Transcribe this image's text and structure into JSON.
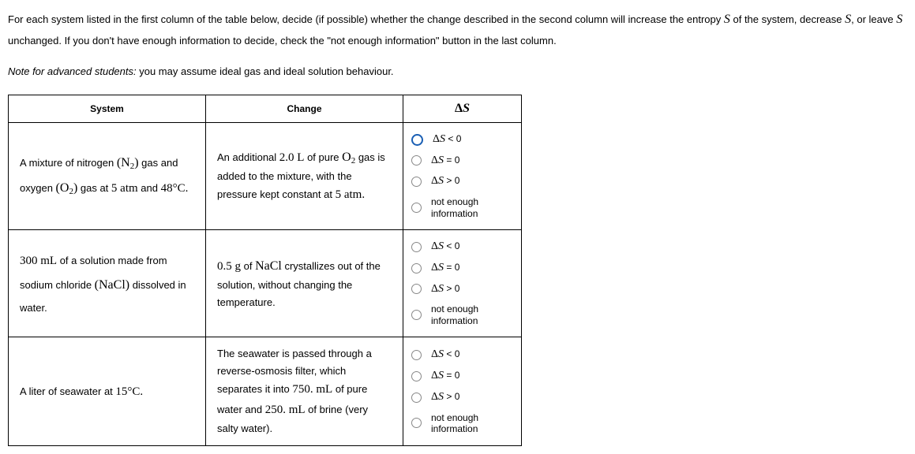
{
  "instructions_p1": "For each system listed in the first column of the table below, decide (if possible) whether the change described in the second column will increase the entropy ",
  "instructions_s1": "S",
  "instructions_p2": " of the system, decrease ",
  "instructions_s2": "S",
  "instructions_p3": ", or leave ",
  "instructions_s3": "S",
  "instructions_p4": " unchanged. If you don't have enough information to decide, check the \"not enough information\" button in the last column.",
  "note_label": "Note for advanced students:",
  "note_text": " you may assume ideal gas and ideal solution behaviour.",
  "headers": {
    "system": "System",
    "change": "Change",
    "delta_sym": "Δ",
    "delta_s": "S"
  },
  "options": {
    "lt": {
      "sym": "Δ",
      "s": "S",
      "op": " < 0"
    },
    "eq": {
      "sym": "Δ",
      "s": "S",
      "op": " = 0"
    },
    "gt": {
      "sym": "Δ",
      "s": "S",
      "op": " > 0"
    },
    "nei": "not enough information"
  },
  "rows": [
    {
      "system": {
        "t1": "A mixture of nitrogen ",
        "f1": "(N",
        "f1sub": "2",
        "f1end": ")",
        "t2": " gas and oxygen ",
        "f2": "(O",
        "f2sub": "2",
        "f2end": ")",
        "t3": " gas at ",
        "v1": "5 atm",
        "t4": " and ",
        "v2": "48°C."
      },
      "change": {
        "t1": "An additional ",
        "v1": "2.0 L",
        "t2": " of pure ",
        "f1": "O",
        "f1sub": "2",
        "t3": " gas is added to the mixture, with the pressure kept constant at ",
        "v2": "5 atm."
      },
      "selected": "lt"
    },
    {
      "system": {
        "v1": "300 mL",
        "t1": " of a solution made from sodium chloride ",
        "f1": "(NaCl)",
        "t2": " dissolved in water."
      },
      "change": {
        "v1": "0.5 g",
        "t1": " of ",
        "f1": "NaCl",
        "t2": " crystallizes out of the solution, without changing the temperature."
      },
      "selected": null
    },
    {
      "system": {
        "t1": "A liter of seawater at ",
        "v1": "15°C."
      },
      "change": {
        "t1": "The seawater is passed through a reverse-osmosis filter, which separates it into ",
        "v1": "750. mL",
        "t2": " of pure water and ",
        "v2": "250. mL",
        "t3": " of brine (very salty water)."
      },
      "selected": null
    }
  ]
}
